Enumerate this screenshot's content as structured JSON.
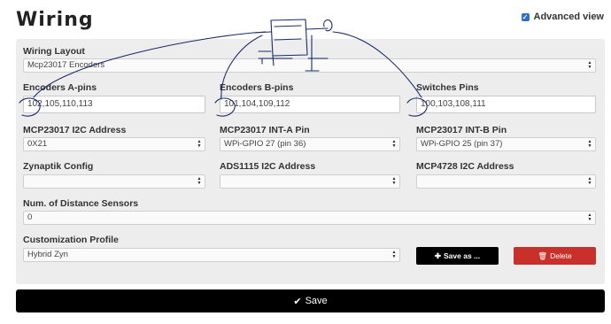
{
  "header": {
    "title": "Wiring",
    "advanced_view_label": "Advanced view",
    "advanced_view_checked": true
  },
  "form": {
    "wiring_layout": {
      "label": "Wiring Layout",
      "value": "Mcp23017 Encoders"
    },
    "encoders_a": {
      "label": "Encoders A-pins",
      "value": "102,105,110,113"
    },
    "encoders_b": {
      "label": "Encoders B-pins",
      "value": "101,104,109,112"
    },
    "switches": {
      "label": "Switches Pins",
      "value": "100,103,108,111"
    },
    "mcp23017_i2c": {
      "label": "MCP23017 I2C Address",
      "value": "0X21"
    },
    "mcp23017_int_a": {
      "label": "MCP23017 INT-A Pin",
      "value": "WPi-GPIO 27 (pin 36)"
    },
    "mcp23017_int_b": {
      "label": "MCP23017 INT-B Pin",
      "value": "WPi-GPIO 25 (pin 37)"
    },
    "zynaptik": {
      "label": "Zynaptik Config",
      "value": ""
    },
    "ads1115": {
      "label": "ADS1115 I2C Address",
      "value": ""
    },
    "mcp4728": {
      "label": "MCP4728 I2C Address",
      "value": ""
    },
    "distance_sensors": {
      "label": "Num. of Distance Sensors",
      "value": "0"
    },
    "customization": {
      "label": "Customization Profile",
      "value": "Hybrid Zyn"
    }
  },
  "buttons": {
    "save_as": "Save as ...",
    "delete": "Delete",
    "save": "Save"
  },
  "colors": {
    "save_bar": "#000000",
    "delete": "#c9302c",
    "panel": "#ededed",
    "checkbox": "#2b6ecf"
  },
  "icons": {
    "save_as": "plus-icon",
    "delete": "trash-icon",
    "save": "check-icon"
  }
}
